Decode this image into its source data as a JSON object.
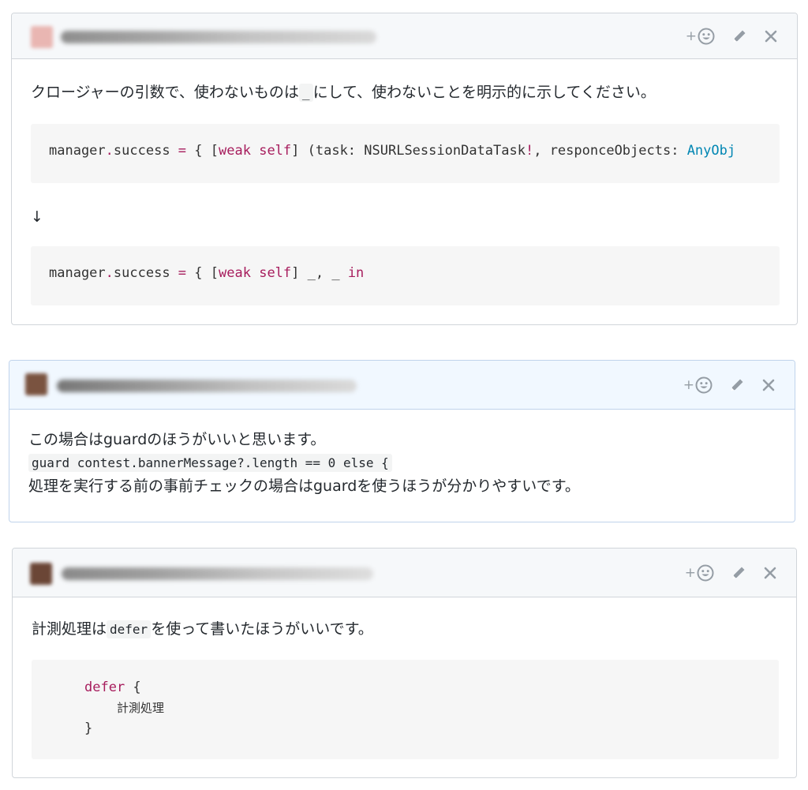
{
  "comments": [
    {
      "text": "クロージャーの引数で、使わないものは",
      "inline_code": "_",
      "text_after": "にして、使わないことを明示的に示してください。",
      "code_before": {
        "a": "manager",
        "dot": ".",
        "b": "success ",
        "eq": "=",
        "c": " { [",
        "kw1": "weak",
        "sp": " ",
        "kw2": "self",
        "d": "] (task: NSURLSessionDataTask",
        "bang": "!",
        "e": ", responceObjects: ",
        "type": "AnyObj"
      },
      "arrow": "↓",
      "code_after": {
        "a": "manager",
        "dot": ".",
        "b": "success ",
        "eq": "=",
        "c": " { [",
        "kw1": "weak",
        "sp": " ",
        "kw2": "self",
        "d": "] _, _ ",
        "kw3": "in"
      }
    },
    {
      "line1": "この場合はguardのほうがいいと思います。",
      "inline_code": "guard contest.bannerMessage?.length == 0 else {",
      "line3": "処理を実行する前の事前チェックの場合はguardを使うほうが分かりやすいです。"
    },
    {
      "text": "計測処理は",
      "inline_code": "defer",
      "text_after": "を使って書いたほうがいいです。",
      "code": {
        "kw": "defer",
        "open": " {",
        "inner": "計測処理",
        "close": "}"
      }
    }
  ],
  "actions": {
    "reaction_plus": "+",
    "reaction_icon": "smiley-icon",
    "edit_icon": "pencil-icon",
    "delete_icon": "close-icon"
  },
  "colors": {
    "header_gray": "#f6f8fa",
    "header_blue": "#f1f8ff",
    "keyword": "#a71d5d",
    "type": "#0086b3",
    "icon": "#959da5"
  }
}
